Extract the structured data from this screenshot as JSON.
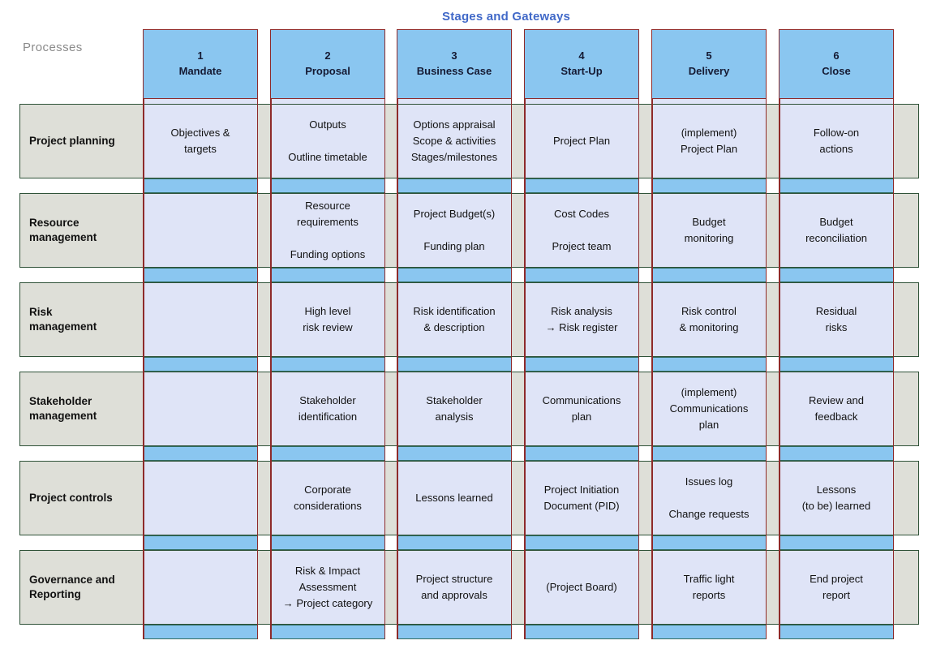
{
  "title": "Stages and Gateways",
  "processes_label": "Processes",
  "colors": {
    "title": "#4169c8",
    "stage_header_fill": "#8ac6f0",
    "stage_header_border": "#8e2a2a",
    "column_fill": "#dfe4f7",
    "row_fill": "#dedfd8",
    "row_border": "#2f5238",
    "gateway_strip": "#8ac6f0",
    "processes_label": "#8a8a8a"
  },
  "stages": [
    {
      "number": "1",
      "name": "Mandate"
    },
    {
      "number": "2",
      "name": "Proposal"
    },
    {
      "number": "3",
      "name": "Business Case"
    },
    {
      "number": "4",
      "name": "Start-Up"
    },
    {
      "number": "5",
      "name": "Delivery"
    },
    {
      "number": "6",
      "name": "Close"
    }
  ],
  "rows": [
    {
      "label": "Project planning",
      "cells": [
        "Objectives &\ntargets",
        "Outputs\n\nOutline timetable",
        "Options appraisal\nScope & activities\nStages/milestones",
        "Project Plan",
        "(implement)\nProject Plan",
        "Follow-on\nactions"
      ]
    },
    {
      "label": "Resource\nmanagement",
      "cells": [
        "",
        "Resource\nrequirements\n\nFunding options",
        "Project Budget(s)\n\nFunding plan",
        "Cost Codes\n\nProject team",
        "Budget\nmonitoring",
        "Budget\nreconciliation"
      ]
    },
    {
      "label": "Risk\nmanagement",
      "cells": [
        "",
        "High level\nrisk review",
        "Risk identification\n& description",
        "Risk analysis\n→ Risk register",
        "Risk control\n& monitoring",
        "Residual\nrisks"
      ]
    },
    {
      "label": "Stakeholder\nmanagement",
      "cells": [
        "",
        "Stakeholder\nidentification",
        "Stakeholder\nanalysis",
        "Communications\nplan",
        "(implement)\nCommunications\nplan",
        "Review and\nfeedback"
      ]
    },
    {
      "label": "Project controls",
      "cells": [
        "",
        "Corporate\nconsiderations",
        "Lessons learned",
        "Project Initiation\nDocument (PID)",
        "Issues log\n\nChange requests",
        "Lessons\n(to be) learned"
      ]
    },
    {
      "label": "Governance and\nReporting",
      "cells": [
        "",
        "Risk & Impact\nAssessment\n→ Project category",
        "Project structure\nand approvals",
        "(Project Board)",
        "Traffic light\nreports",
        "End project\nreport"
      ]
    }
  ]
}
